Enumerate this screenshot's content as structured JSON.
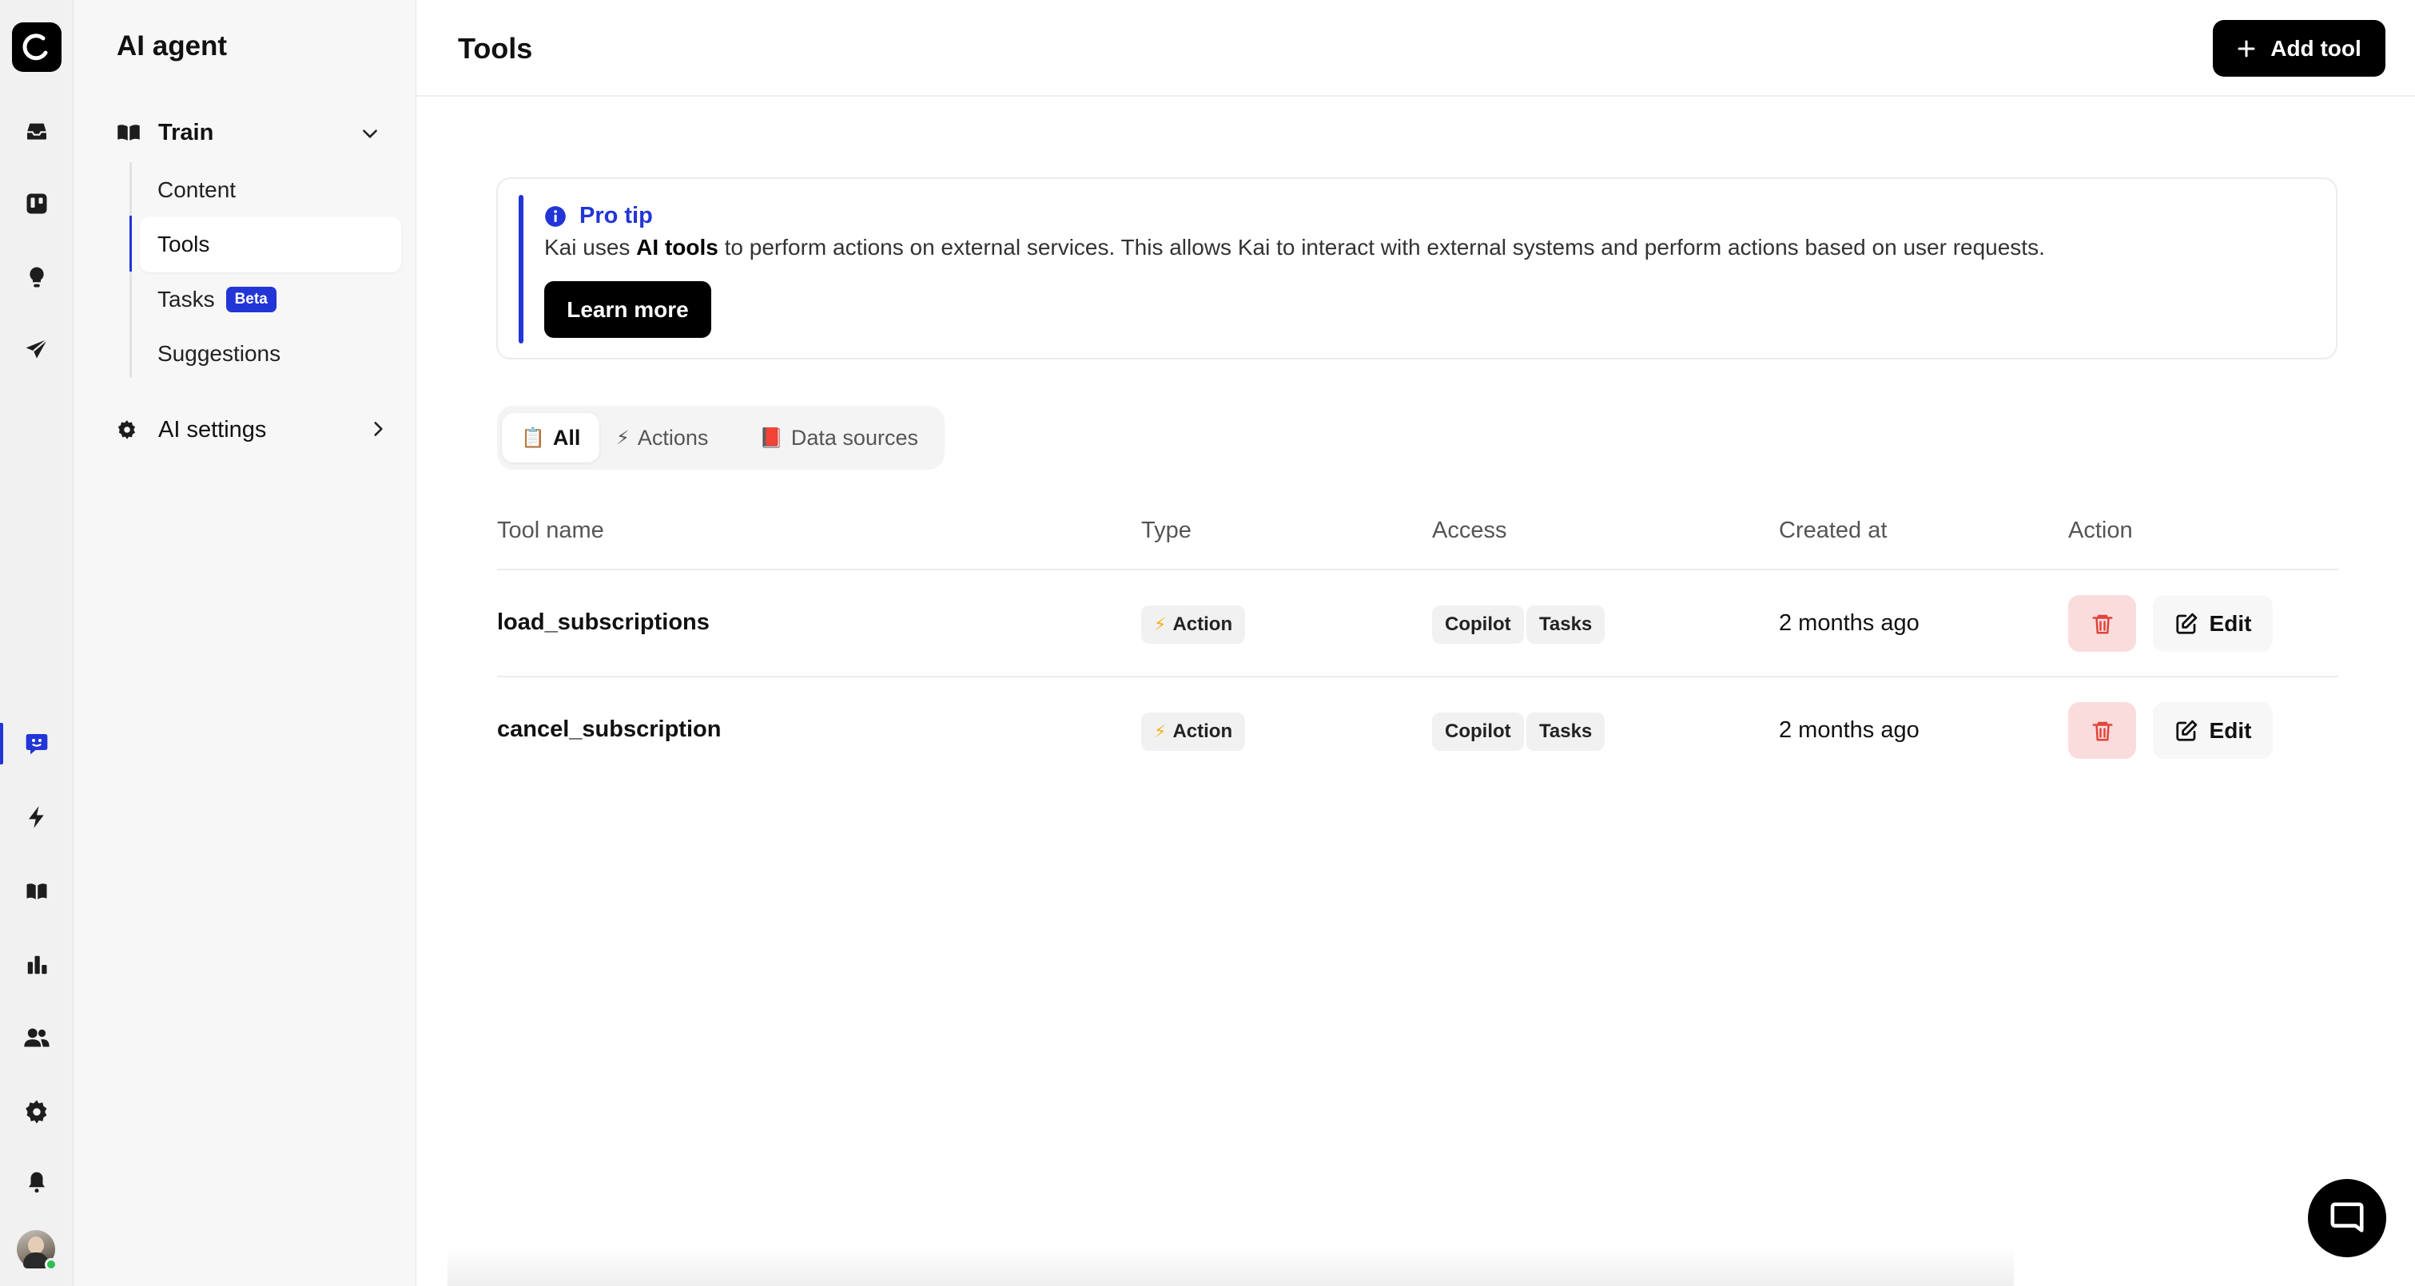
{
  "app": {
    "section_title": "AI agent",
    "page_title": "Tools",
    "add_tool_label": "Add tool",
    "accent_color": "#2235d6"
  },
  "rail": {
    "items": [
      {
        "icon": "inbox-icon"
      },
      {
        "icon": "kanban-icon"
      },
      {
        "icon": "lightbulb-icon"
      },
      {
        "icon": "send-icon"
      },
      {
        "icon": "ai-agent-icon",
        "active": true
      },
      {
        "icon": "lightning-icon"
      },
      {
        "icon": "book-icon"
      },
      {
        "icon": "bar-chart-icon"
      },
      {
        "icon": "users-icon"
      },
      {
        "icon": "gear-icon"
      },
      {
        "icon": "bell-icon"
      }
    ]
  },
  "sidebar": {
    "train_label": "Train",
    "items": [
      {
        "label": "Content"
      },
      {
        "label": "Tools",
        "active": true
      },
      {
        "label": "Tasks",
        "badge": "Beta"
      },
      {
        "label": "Suggestions"
      }
    ],
    "settings_label": "AI settings"
  },
  "tip": {
    "title": "Pro tip",
    "text_before": "Kai uses ",
    "text_bold": "AI tools",
    "text_after": " to perform actions on external services. This allows Kai to interact with external systems and perform actions based on user requests.",
    "button": "Learn more"
  },
  "filters": [
    {
      "emoji": "📋",
      "label": "All",
      "active": true
    },
    {
      "emoji": "⚡",
      "label": "Actions"
    },
    {
      "emoji": "📕",
      "label": "Data sources"
    }
  ],
  "table": {
    "headers": [
      "Tool name",
      "Type",
      "Access",
      "Created at",
      "Action"
    ],
    "rows": [
      {
        "name": "load_subscriptions",
        "type": "Action",
        "access": [
          "Copilot",
          "Tasks"
        ],
        "created": "2 months ago",
        "edit": "Edit"
      },
      {
        "name": "cancel_subscription",
        "type": "Action",
        "access": [
          "Copilot",
          "Tasks"
        ],
        "created": "2 months ago",
        "edit": "Edit"
      }
    ]
  }
}
